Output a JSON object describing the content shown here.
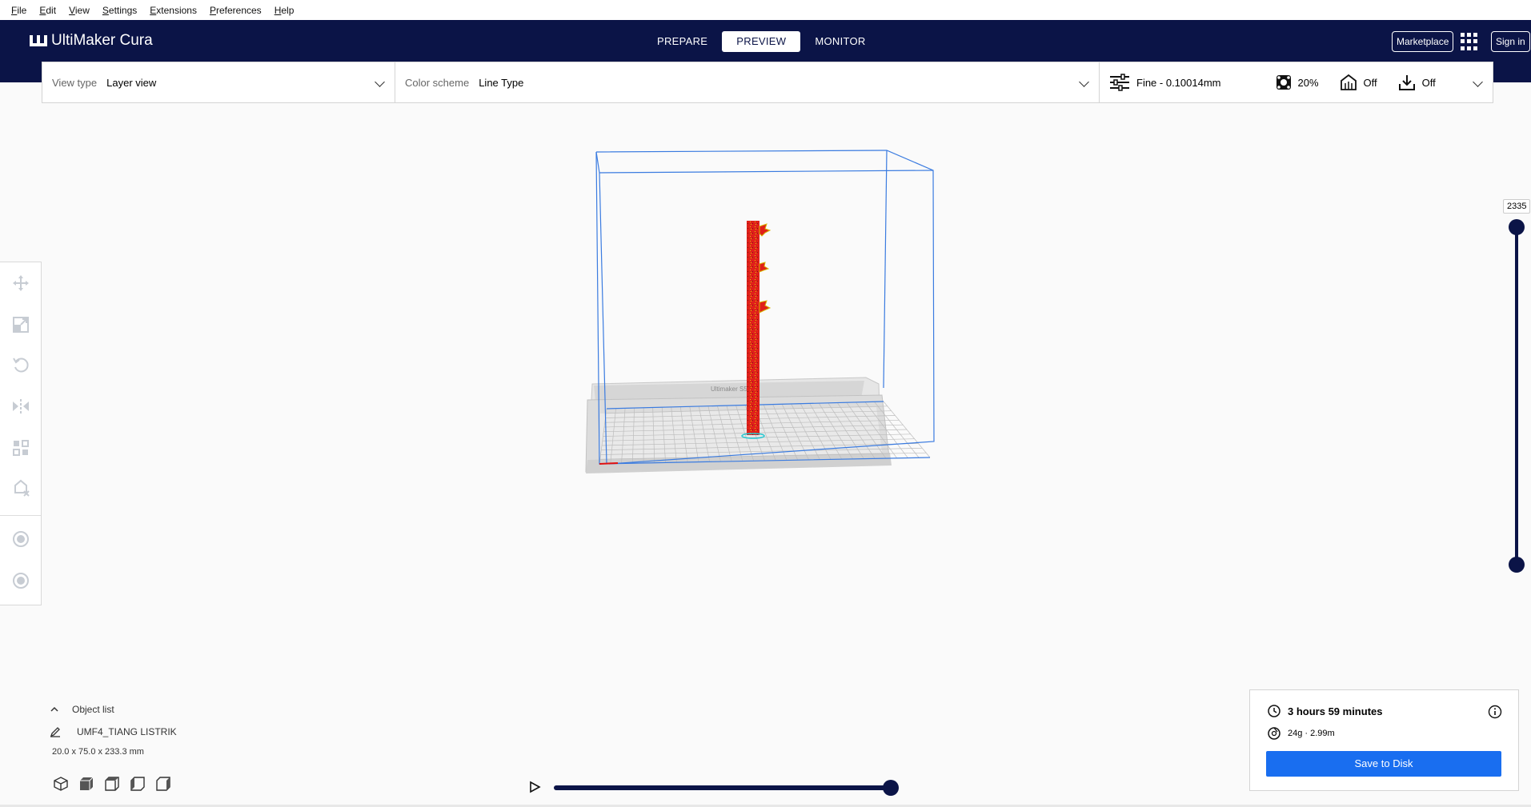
{
  "menu": [
    "File",
    "Edit",
    "View",
    "Settings",
    "Extensions",
    "Preferences",
    "Help"
  ],
  "header": {
    "app_name": "UltiMaker Cura",
    "stages": [
      "PREPARE",
      "PREVIEW",
      "MONITOR"
    ],
    "active_stage": "PREVIEW",
    "marketplace_label": "Marketplace",
    "signin_label": "Sign in"
  },
  "toolbar": {
    "view_type_label": "View type",
    "view_type_value": "Layer view",
    "color_scheme_label": "Color scheme",
    "color_scheme_value": "Line Type",
    "profile": "Fine - 0.10014mm",
    "infill": "20%",
    "support": "Off",
    "adhesion": "Off"
  },
  "viewport": {
    "build_plate_text": "Ultimaker S5"
  },
  "layer_slider": {
    "value": "2335"
  },
  "object_list": {
    "label": "Object list",
    "object_name": "UMF4_TIANG LISTRIK",
    "dimensions": "20.0 x 75.0 x 233.3 mm"
  },
  "print_info": {
    "time": "3 hours 59 minutes",
    "material": "24g · 2.99m",
    "save_label": "Save to Disk"
  },
  "colors": {
    "header_bg": "#0b1447",
    "accent_blue": "#196ef0",
    "build_volume": "#3a7be0",
    "model_red": "#e0201a"
  }
}
